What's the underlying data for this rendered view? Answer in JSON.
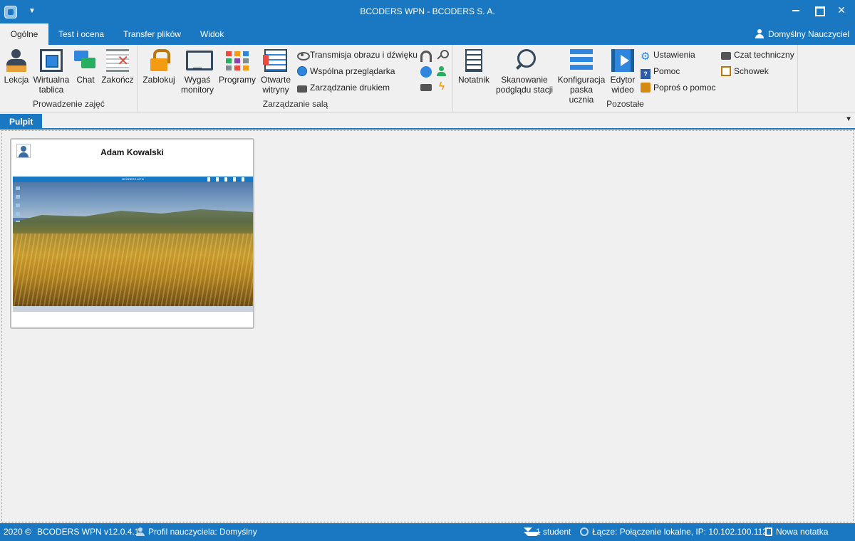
{
  "window": {
    "title": "BCODERS WPN - BCODERS S. A."
  },
  "ribbon_tabs": [
    {
      "label": "Ogólne",
      "active": true
    },
    {
      "label": "Test i ocena",
      "active": false
    },
    {
      "label": "Transfer plików",
      "active": false
    },
    {
      "label": "Widok",
      "active": false
    }
  ],
  "user": {
    "label": "Domyślny Nauczyciel",
    "icon": "user-icon"
  },
  "groups": {
    "prowadzenie": {
      "label": "Prowadzenie zajęć",
      "buttons": [
        {
          "label": "Lekcja",
          "icon": "teacher-icon"
        },
        {
          "label": "Wirtualna tablica",
          "icon": "whiteboard-icon"
        },
        {
          "label": "Chat",
          "icon": "chat-icon"
        },
        {
          "label": "Zakończ",
          "icon": "end-lesson-icon"
        }
      ]
    },
    "zarzadzanie": {
      "label": "Zarządzanie salą",
      "buttons": [
        {
          "label": "Zablokuj",
          "icon": "lock-icon"
        },
        {
          "label": "Wygaś monitory",
          "icon": "monitor-icon"
        },
        {
          "label": "Programy",
          "icon": "programs-icon"
        },
        {
          "label": "Otwarte witryny",
          "icon": "websites-icon"
        }
      ],
      "small": [
        {
          "label": "Transmisja obrazu i dźwięku",
          "icon": "eye-icon"
        },
        {
          "label": "Wspólna przeglądarka",
          "icon": "globe-icon"
        },
        {
          "label": "Zarządzanie drukiem",
          "icon": "printer-icon"
        }
      ],
      "icon_only": [
        "headset-icon",
        "key-icon",
        "web-icon",
        "user-green-icon",
        "keyboard-icon",
        "power-icon"
      ]
    },
    "pozostale": {
      "label": "Pozostałe",
      "buttons": [
        {
          "label": "Notatnik",
          "icon": "notepad-icon"
        },
        {
          "label": "Skanowanie podglądu stacji",
          "icon": "scan-icon"
        },
        {
          "label": "Konfiguracja paska ucznia",
          "icon": "toolbar-config-icon"
        },
        {
          "label": "Edytor wideo",
          "icon": "video-editor-icon"
        }
      ],
      "small_col1": [
        {
          "label": "Ustawienia",
          "icon": "gear-icon"
        },
        {
          "label": "Pomoc",
          "icon": "help-icon"
        },
        {
          "label": "Poproś o pomoc",
          "icon": "ask-help-icon"
        }
      ],
      "small_col2": [
        {
          "label": "Czat techniczny",
          "icon": "tech-chat-icon"
        },
        {
          "label": "Schowek",
          "icon": "clipboard-icon"
        }
      ]
    }
  },
  "doc_tabs": [
    {
      "label": "Pulpit",
      "active": true
    }
  ],
  "stations": [
    {
      "name": "Adam Kowalski",
      "preview": {
        "title": "BCODERS WPN"
      }
    }
  ],
  "status": {
    "copyright": "2020 ©",
    "version": "BCODERS WPN v12.0.4.1",
    "profile": "Profil nauczyciela: Domyślny",
    "students": "1 student",
    "connection": "Łącze: Połączenie lokalne, IP: 10.102.100.112",
    "note": "Nowa notatka"
  },
  "colors": {
    "accent": "#1a78c2",
    "background": "#f0f0f0"
  }
}
